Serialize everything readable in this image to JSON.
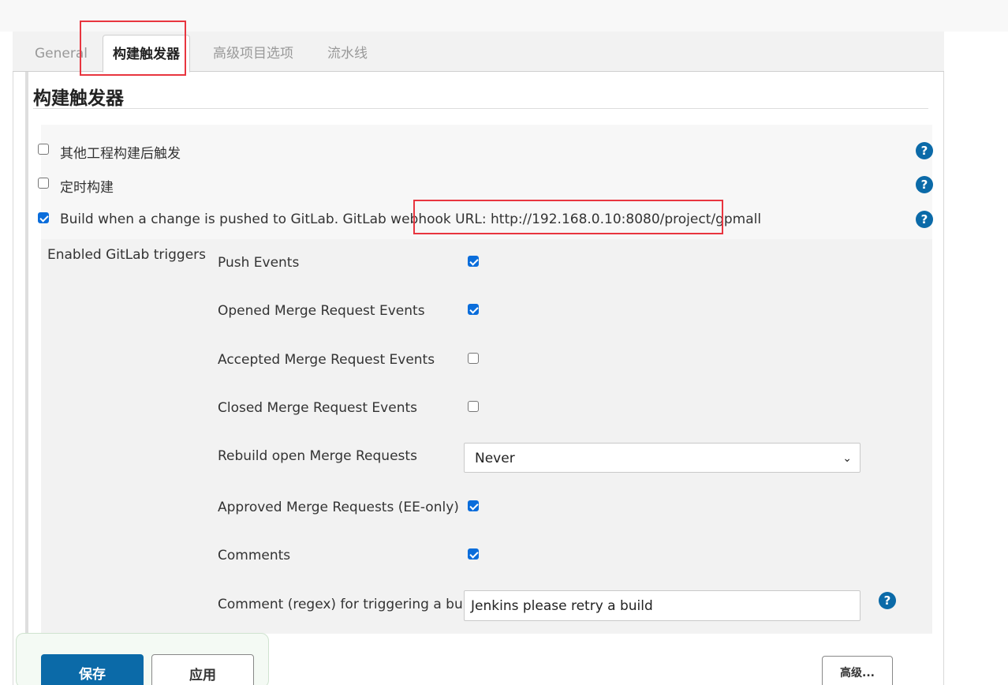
{
  "tabs": [
    {
      "label": "General"
    },
    {
      "label": "构建触发器"
    },
    {
      "label": "高级项目选项"
    },
    {
      "label": "流水线"
    }
  ],
  "section": {
    "title": "构建触发器"
  },
  "triggers": [
    {
      "label": "其他工程构建后触发",
      "checked": false
    },
    {
      "label": "定时构建",
      "checked": false
    },
    {
      "label": "Build when a change is pushed to GitLab. GitLab webhook URL: http://192.168.0.10:8080/project/gpmall",
      "checked": true
    }
  ],
  "gitlab": {
    "group_label": "Enabled GitLab triggers",
    "options": [
      {
        "label": "Push Events",
        "checked": true
      },
      {
        "label": "Opened Merge Request Events",
        "checked": true
      },
      {
        "label": "Accepted Merge Request Events",
        "checked": false
      },
      {
        "label": "Closed Merge Request Events",
        "checked": false
      },
      {
        "label": "Rebuild open Merge Requests",
        "value": "Never"
      },
      {
        "label": "Approved Merge Requests (EE-only)",
        "checked": true
      },
      {
        "label": "Comments",
        "checked": true
      },
      {
        "label": "Comment (regex) for triggering a build",
        "value": "Jenkins please retry a build"
      }
    ]
  },
  "buttons": {
    "save": "保存",
    "apply": "应用",
    "advanced": "高级..."
  },
  "colors": {
    "accent": "#0b6aa8",
    "highlight": "#e8353f",
    "checkbox": "#0a6ddb"
  }
}
